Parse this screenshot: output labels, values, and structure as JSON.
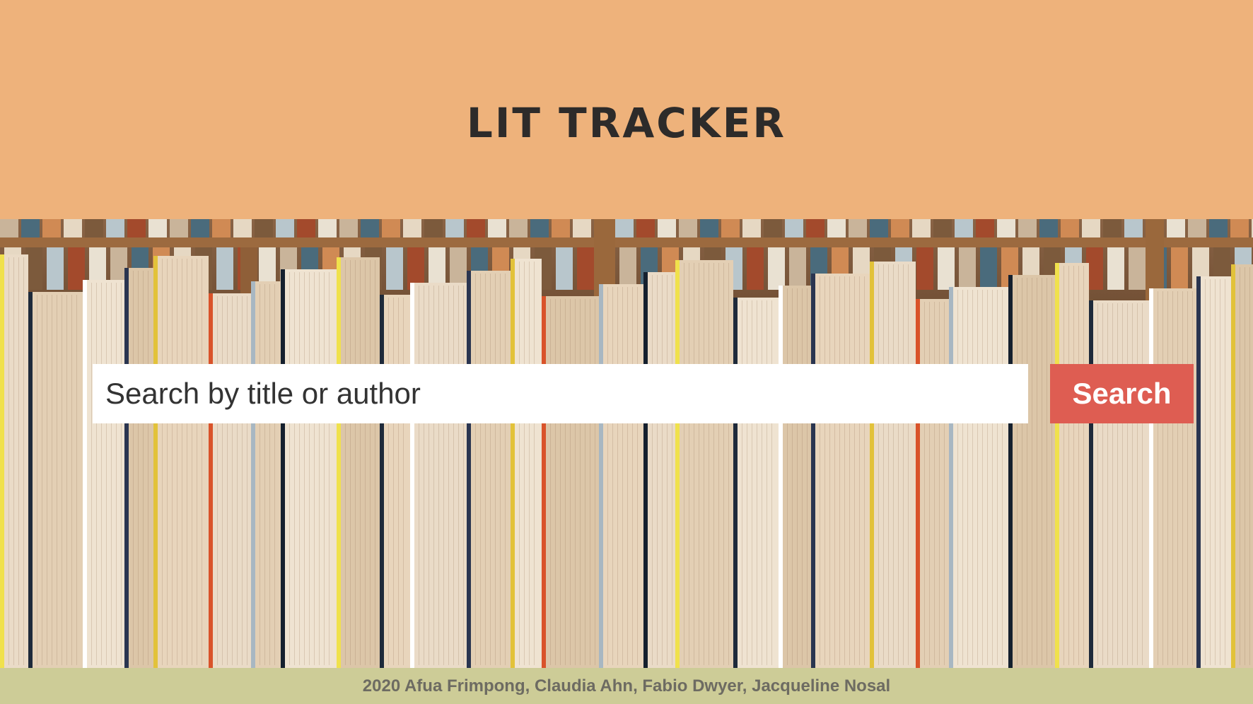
{
  "header": {
    "title": "LIT TRACKER"
  },
  "search": {
    "placeholder": "Search by title or author",
    "button_label": "Search"
  },
  "footer": {
    "credits": "2020 Afua Frimpong, Claudia Ahn, Fabio Dwyer, Jacqueline Nosal"
  },
  "colors": {
    "header_bg": "#eeb27b",
    "button_bg": "#de5d52",
    "footer_bg": "#cdcc97",
    "title_text": "#2d2b2a"
  }
}
